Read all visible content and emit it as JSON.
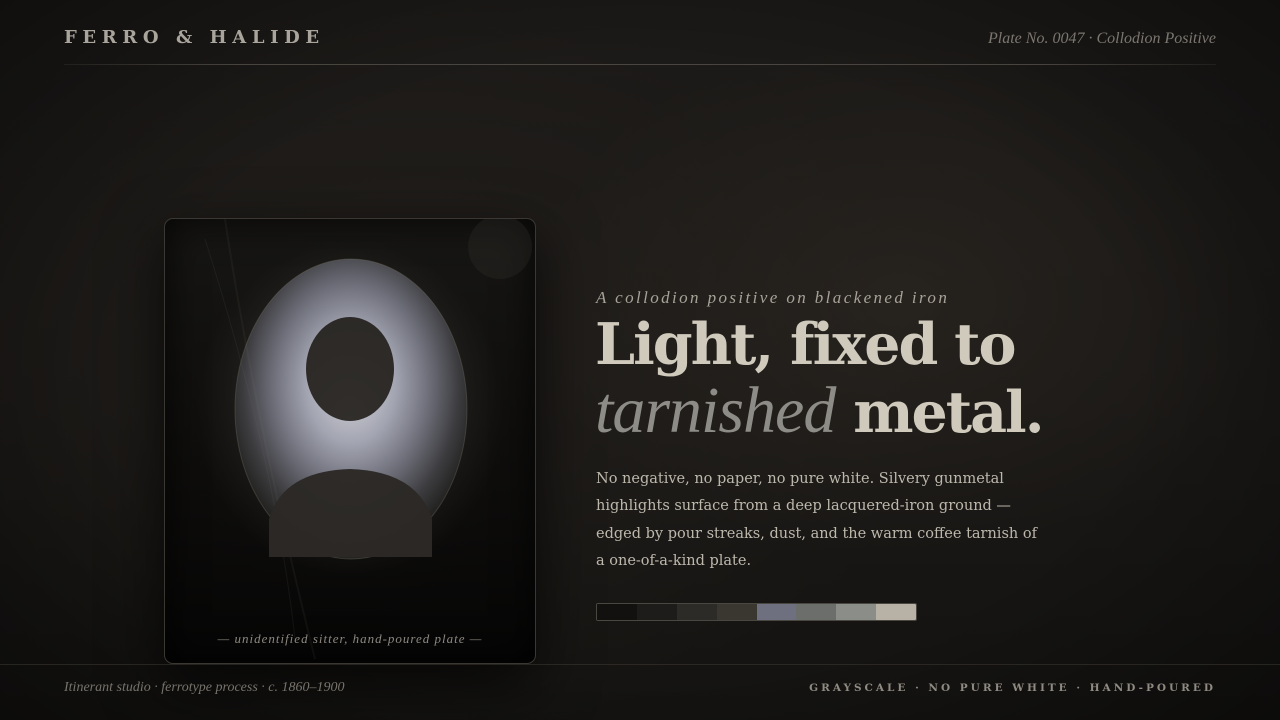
{
  "header": {
    "brand": "FERRO & HALIDE",
    "plate_label": "Plate No. 0047 · Collodion Positive"
  },
  "plate": {
    "caption": "— unidentified sitter, hand-poured plate —",
    "colors": {
      "ground": "#0c0b0a",
      "halo": "#8e90a0",
      "figure": "#2b2826"
    }
  },
  "hero": {
    "kicker": "A collodion positive on blackened iron",
    "headline_line1": "Light, fixed to",
    "headline_italic": "tarnished",
    "headline_end": "metal.",
    "body": "No negative, no paper, no pure white. Silvery gunmetal highlights surface from a deep lacquered-iron ground — edged by pour streaks, dust, and the warm coffee tarnish of a one-of-a-kind plate."
  },
  "palette": {
    "swatches": [
      "#121110",
      "#1e1c1a",
      "#2d2b28",
      "#3a3630",
      "#6e7080",
      "#6b6e6a",
      "#8a8d88",
      "#b8b2a6"
    ]
  },
  "footer": {
    "left": "Itinerant studio · ferrotype process · c. 1860–1900",
    "right": "GRAYSCALE · NO PURE WHITE · HAND-POURED"
  }
}
